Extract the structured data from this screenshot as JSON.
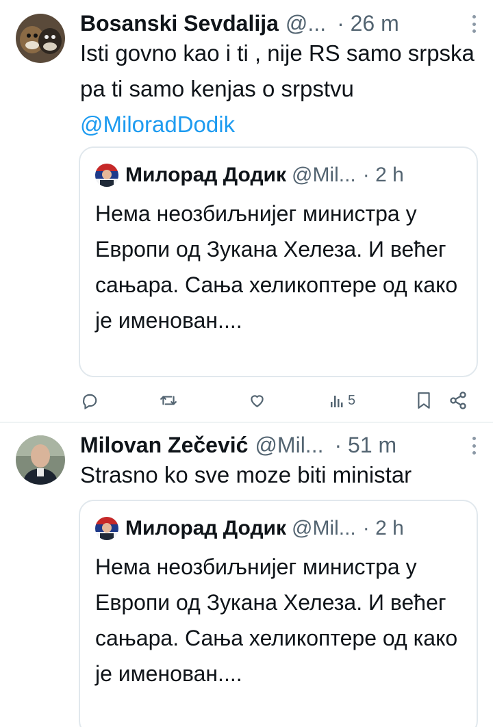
{
  "tweets": [
    {
      "author_name": "Bosanski Sevdalija",
      "handle": "@...",
      "time": "· 26 m",
      "text_plain": "Isti govno kao i ti , nije RS samo srpska pa ti samo kenjas o srpstvu ",
      "mention": "@MiloradDodik",
      "quote": {
        "author_name": "Милорад Додик",
        "handle": "@Mil...",
        "time": "· 2 h",
        "text": "Нема неозбиљнијег министра у Европи од Зукана Хелеза. И већег сањара. Сања хеликоптере од како је именован...."
      },
      "actions": {
        "reply_icon": "reply-icon",
        "retweet_icon": "retweet-icon",
        "like_icon": "heart-icon",
        "views_icon": "views-icon",
        "views_count": "5",
        "bookmark_icon": "bookmark-icon",
        "share_icon": "share-icon"
      }
    },
    {
      "author_name": "Milovan Zečević",
      "handle": "@Mil...",
      "time": "· 51 m",
      "text_plain": "Strasno ko sve moze biti ministar",
      "quote": {
        "author_name": "Милорад Додик",
        "handle": "@Mil...",
        "time": "· 2 h",
        "text": "Нема неозбиљнијег министра у Европи од Зукана Хелеза. И већег сањара. Сања хеликоптере од како је именован...."
      }
    }
  ],
  "colors": {
    "text": "#0f1419",
    "secondary": "#536471",
    "link": "#1d9bf0",
    "border": "#e1e8ed"
  }
}
